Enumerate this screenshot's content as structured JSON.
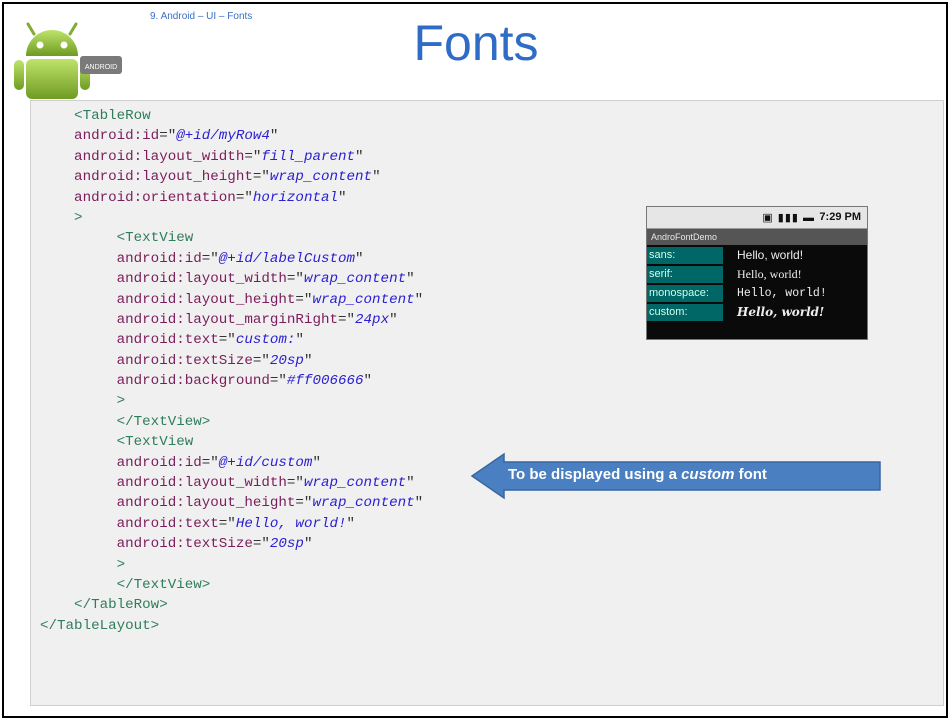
{
  "header": {
    "breadcrumb": "9. Android – UI – Fonts",
    "title": "Fonts",
    "logo_text": "ANDROID"
  },
  "code_lines": [
    [
      {
        "c": "tag",
        "t": "    <TableRow"
      }
    ],
    [
      {
        "c": "attr",
        "t": "    android:id"
      },
      {
        "c": "eq",
        "t": "=\""
      },
      {
        "c": "val",
        "t": "@+id/myRow4"
      },
      {
        "c": "eq",
        "t": "\""
      }
    ],
    [
      {
        "c": "attr",
        "t": "    android:layout_width"
      },
      {
        "c": "eq",
        "t": "=\""
      },
      {
        "c": "val",
        "t": "fill_parent"
      },
      {
        "c": "eq",
        "t": "\""
      }
    ],
    [
      {
        "c": "attr",
        "t": "    android:layout_height"
      },
      {
        "c": "eq",
        "t": "=\""
      },
      {
        "c": "val",
        "t": "wrap_content"
      },
      {
        "c": "eq",
        "t": "\""
      }
    ],
    [
      {
        "c": "attr",
        "t": "    android:orientation"
      },
      {
        "c": "eq",
        "t": "=\""
      },
      {
        "c": "val",
        "t": "horizontal"
      },
      {
        "c": "eq",
        "t": "\""
      }
    ],
    [
      {
        "c": "bracket",
        "t": "    >"
      }
    ],
    [
      {
        "c": "tag",
        "t": "         <TextView"
      }
    ],
    [
      {
        "c": "attr",
        "t": "         android:id"
      },
      {
        "c": "eq",
        "t": "=\""
      },
      {
        "c": "val",
        "t": "@+id/labelCustom"
      },
      {
        "c": "eq",
        "t": "\""
      }
    ],
    [
      {
        "c": "attr",
        "t": "         android:layout_width"
      },
      {
        "c": "eq",
        "t": "=\""
      },
      {
        "c": "val",
        "t": "wrap_content"
      },
      {
        "c": "eq",
        "t": "\""
      }
    ],
    [
      {
        "c": "attr",
        "t": "         android:layout_height"
      },
      {
        "c": "eq",
        "t": "=\""
      },
      {
        "c": "val",
        "t": "wrap_content"
      },
      {
        "c": "eq",
        "t": "\""
      }
    ],
    [
      {
        "c": "attr",
        "t": "         android:layout_marginRight"
      },
      {
        "c": "eq",
        "t": "=\""
      },
      {
        "c": "val",
        "t": "24px"
      },
      {
        "c": "eq",
        "t": "\""
      }
    ],
    [
      {
        "c": "attr",
        "t": "         android:text"
      },
      {
        "c": "eq",
        "t": "=\""
      },
      {
        "c": "val",
        "t": "custom:"
      },
      {
        "c": "eq",
        "t": "\""
      }
    ],
    [
      {
        "c": "attr",
        "t": "         android:textSize"
      },
      {
        "c": "eq",
        "t": "=\""
      },
      {
        "c": "val",
        "t": "20sp"
      },
      {
        "c": "eq",
        "t": "\""
      }
    ],
    [
      {
        "c": "attr",
        "t": "         android:background"
      },
      {
        "c": "eq",
        "t": "=\""
      },
      {
        "c": "val",
        "t": "#ff006666"
      },
      {
        "c": "eq",
        "t": "\""
      }
    ],
    [
      {
        "c": "bracket",
        "t": "         >"
      }
    ],
    [
      {
        "c": "tag",
        "t": "         </TextView>"
      }
    ],
    [
      {
        "c": "tag",
        "t": "         <TextView"
      }
    ],
    [
      {
        "c": "attr",
        "t": "         android:id"
      },
      {
        "c": "eq",
        "t": "=\""
      },
      {
        "c": "val",
        "t": "@+id/custom"
      },
      {
        "c": "eq",
        "t": "\""
      }
    ],
    [
      {
        "c": "attr",
        "t": "         android:layout_width"
      },
      {
        "c": "eq",
        "t": "=\""
      },
      {
        "c": "val",
        "t": "wrap_content"
      },
      {
        "c": "eq",
        "t": "\""
      }
    ],
    [
      {
        "c": "attr",
        "t": "         android:layout_height"
      },
      {
        "c": "eq",
        "t": "=\""
      },
      {
        "c": "val",
        "t": "wrap_content"
      },
      {
        "c": "eq",
        "t": "\""
      }
    ],
    [
      {
        "c": "attr",
        "t": "         android:text"
      },
      {
        "c": "eq",
        "t": "=\""
      },
      {
        "c": "val",
        "t": "Hello, world!"
      },
      {
        "c": "eq",
        "t": "\""
      }
    ],
    [
      {
        "c": "attr",
        "t": "         android:textSize"
      },
      {
        "c": "eq",
        "t": "=\""
      },
      {
        "c": "val",
        "t": "20sp"
      },
      {
        "c": "eq",
        "t": "\""
      }
    ],
    [
      {
        "c": "bracket",
        "t": "         >"
      }
    ],
    [
      {
        "c": "tag",
        "t": "         </TextView>"
      }
    ],
    [
      {
        "c": "tag",
        "t": "    </TableRow>"
      }
    ],
    [
      {
        "c": "tag",
        "t": "</TableLayout>"
      }
    ]
  ],
  "phone": {
    "status_time": "7:29 PM",
    "status_icons": "▣ ▮▮▮ ▬",
    "app_title": "AndroFontDemo",
    "rows": [
      {
        "label": "sans:",
        "text": "Hello, world!",
        "style": ""
      },
      {
        "label": "serif:",
        "text": "Hello, world!",
        "style": "serif"
      },
      {
        "label": "monospace:",
        "text": "Hello, world!",
        "style": "mono"
      },
      {
        "label": "custom:",
        "text": "Hello, world!",
        "style": "custom"
      }
    ]
  },
  "callout": {
    "text_before": "To be displayed using a ",
    "text_emph": "custom",
    "text_after": " font"
  },
  "colors": {
    "title_blue": "#2f6cc6",
    "callout_fill": "#4a7fc1",
    "row_label_bg": "#006666"
  }
}
